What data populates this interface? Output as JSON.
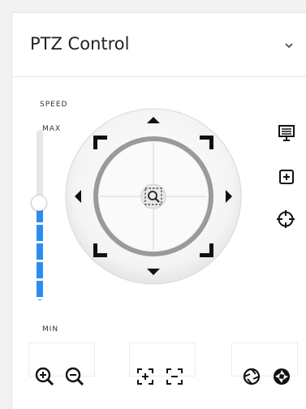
{
  "panel": {
    "title": "PTZ Control",
    "collapse_icon": "chevron-down-icon"
  },
  "speed": {
    "label": "SPEED",
    "max_label": "MAX",
    "min_label": "MIN",
    "level_fraction": 0.55,
    "fill_color": "#2d8cf0"
  },
  "joystick": {
    "directions": [
      "up",
      "up-right",
      "right",
      "down-right",
      "down",
      "down-left",
      "left",
      "up-left"
    ],
    "center_icon": "zoom-area-icon",
    "arrow_color": "#111111"
  },
  "side_tools": [
    {
      "icon": "presentation-screen-icon"
    },
    {
      "icon": "add-box-icon"
    },
    {
      "icon": "crosshair-target-icon"
    }
  ],
  "bottom_tools": [
    {
      "icon": "zoom-in-icon"
    },
    {
      "icon": "zoom-out-icon"
    },
    {
      "icon": "focus-near-icon"
    },
    {
      "icon": "focus-far-icon"
    },
    {
      "icon": "iris-open-icon"
    },
    {
      "icon": "iris-close-icon"
    }
  ]
}
